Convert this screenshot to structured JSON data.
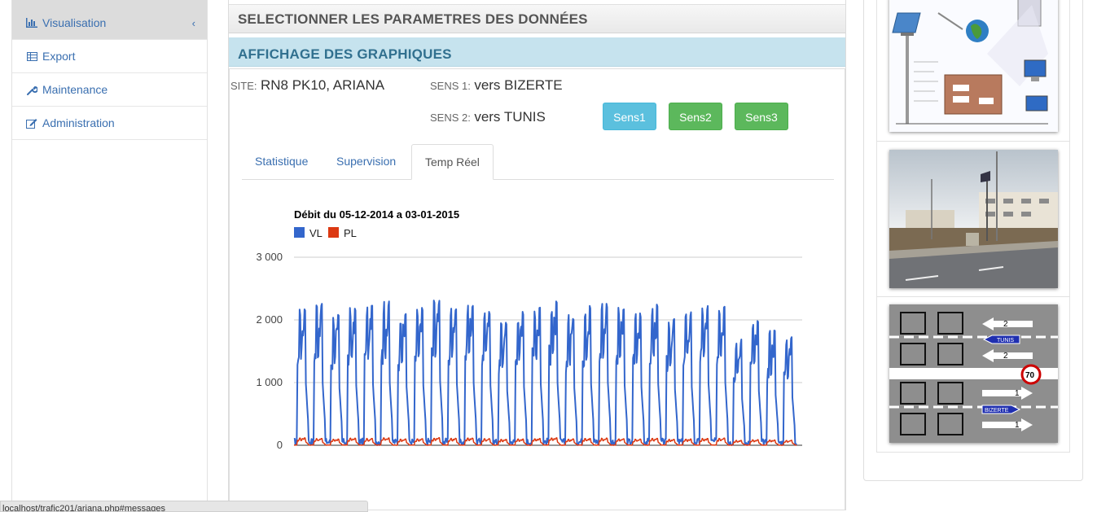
{
  "sidebar": {
    "items": [
      {
        "label": "Visualisation",
        "icon": "bar-chart-icon",
        "active": true
      },
      {
        "label": "Export",
        "icon": "table-icon"
      },
      {
        "label": "Maintenance",
        "icon": "wrench-icon"
      },
      {
        "label": "Administration",
        "icon": "edit-icon"
      }
    ],
    "active_chevron": "‹"
  },
  "main": {
    "section1_title": "SELECTIONNER LES PARAMETRES DES DONNÉES",
    "section2_title": "AFFICHAGE DES GRAPHIQUES",
    "site_label": "SITE:",
    "site_value": "RN8 PK10, ARIANA",
    "sens1_label": "SENS 1:",
    "sens1_value": "vers BIZERTE",
    "sens2_label": "SENS 2:",
    "sens2_value": "vers TUNIS",
    "buttons": [
      {
        "label": "Sens1",
        "style": "info"
      },
      {
        "label": "Sens2",
        "style": "success"
      },
      {
        "label": "Sens3",
        "style": "success"
      }
    ],
    "tabs": [
      {
        "label": "Statistique"
      },
      {
        "label": "Supervision"
      },
      {
        "label": "Temp Réel",
        "active": true
      }
    ]
  },
  "chart_data": {
    "type": "line",
    "title": "Débit du 05-12-2014 a 03-01-2015",
    "ylim": [
      0,
      3000
    ],
    "yticks": [
      "3 000",
      "2 000",
      "1 000",
      "0"
    ],
    "ytick_values": [
      3000,
      2000,
      1000,
      0
    ],
    "series": [
      {
        "name": "VL",
        "color": "#3366cc",
        "daily_peaks": [
          2250,
          2300,
          2100,
          2200,
          2250,
          2300,
          2150,
          2200,
          2350,
          2250,
          2300,
          2200,
          2000,
          2150,
          2250,
          2300,
          2100,
          2250,
          2300,
          2200,
          2150,
          2250,
          2050,
          2150,
          2250,
          2300,
          1700,
          2000,
          1850,
          1750
        ],
        "night_min": 0
      },
      {
        "name": "PL",
        "color": "#dc3912",
        "daily_peaks": [
          120,
          110,
          100,
          115,
          110,
          120,
          100,
          105,
          120,
          110,
          115,
          105,
          95,
          100,
          110,
          120,
          100,
          110,
          115,
          105,
          100,
          110,
          95,
          100,
          110,
          115,
          80,
          90,
          85,
          80
        ],
        "night_min": 0
      }
    ],
    "grid": true,
    "legend": "top-left"
  },
  "status_bar": {
    "url": "localhost/trafic201/ariana.php#messages"
  },
  "colors": {
    "link": "#3a6fb0",
    "info": "#5bc0de",
    "success": "#5cb85c",
    "header_blue_bg": "#c6e3ee",
    "header_blue_text": "#31708f"
  },
  "right_panel": {
    "images": [
      {
        "name": "system-diagram-image"
      },
      {
        "name": "roadside-photo-image"
      },
      {
        "name": "lane-diagram-image",
        "labels": {
          "top_arrow": "2",
          "city_top": "TUNIS",
          "mid_arrow": "2",
          "speed": "70",
          "low_arrow": "1",
          "city_bottom": "BIZERTE",
          "bottom_arrow": "1"
        }
      }
    ]
  }
}
